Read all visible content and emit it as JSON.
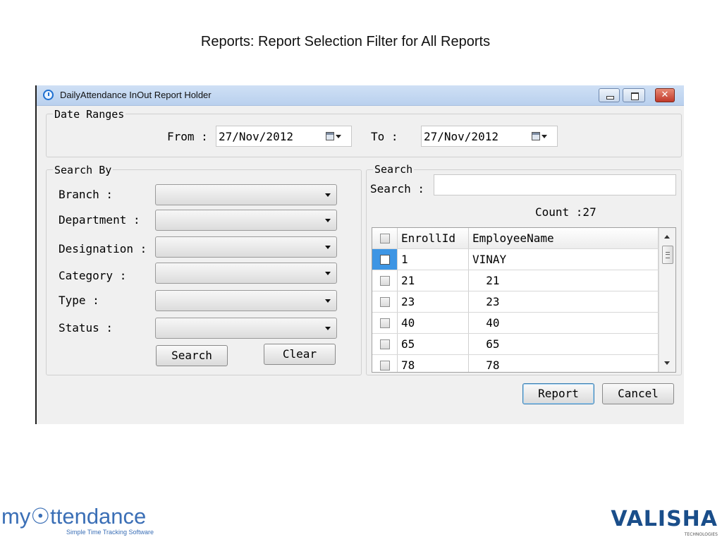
{
  "slide": {
    "title": "Reports: Report Selection Filter for All Reports"
  },
  "window": {
    "title": "DailyAttendance InOut Report Holder",
    "close_glyph": "✕"
  },
  "date_ranges": {
    "group_label": "Date Ranges",
    "from_label": "From :",
    "from_value": "27/Nov/2012",
    "to_label": "To  :",
    "to_value": "27/Nov/2012"
  },
  "search_by": {
    "group_label": "Search By",
    "fields": [
      {
        "label": "Branch :",
        "value": ""
      },
      {
        "label": "Department :",
        "value": ""
      },
      {
        "label": "Designation :",
        "value": ""
      },
      {
        "label": "Category :",
        "value": ""
      },
      {
        "label": "Type :",
        "value": ""
      },
      {
        "label": "Status :",
        "value": ""
      }
    ],
    "search_button": "Search",
    "clear_button": "Clear"
  },
  "search": {
    "group_label": "Search",
    "search_label": "Search :",
    "search_value": "",
    "count_label": "Count :27"
  },
  "grid": {
    "columns": [
      "EnrollId",
      "EmployeeName"
    ],
    "rows": [
      {
        "enroll_id": "1",
        "employee_name": "VINAY"
      },
      {
        "enroll_id": "21",
        "employee_name": "  21"
      },
      {
        "enroll_id": "23",
        "employee_name": "  23"
      },
      {
        "enroll_id": "40",
        "employee_name": "  40"
      },
      {
        "enroll_id": "65",
        "employee_name": "  65"
      },
      {
        "enroll_id": "78",
        "employee_name": "  78"
      }
    ]
  },
  "actions": {
    "report_button": "Report",
    "cancel_button": "Cancel"
  },
  "logos": {
    "left_word": "my☉ttendance",
    "left_tagline": "Simple Time Tracking Software",
    "right_word": "valisha",
    "right_tagline": "TECHNOLOGIES"
  },
  "colors": {
    "accent": "#3d95e4",
    "titlebar": "#c4d8f2",
    "logo_blue": "#3b6fb6",
    "close_red": "#c0392b"
  }
}
